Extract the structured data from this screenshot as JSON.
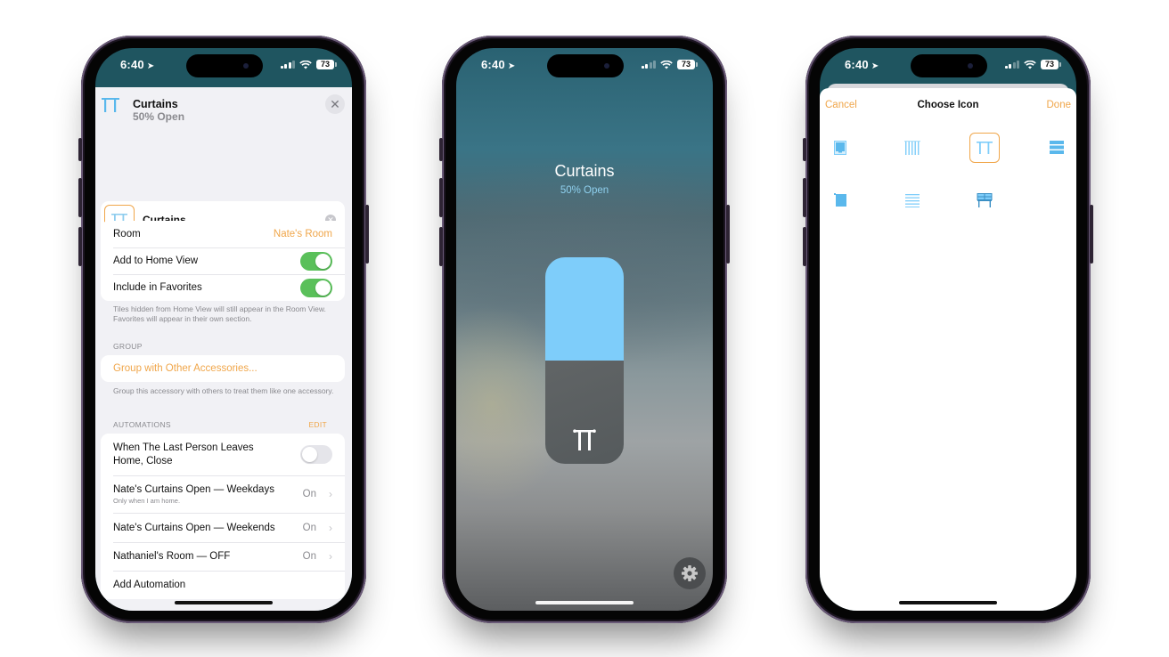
{
  "status_bar": {
    "time": "6:40",
    "battery": "73",
    "location_icon": "location-arrow-icon",
    "signal_icon": "cellular-signal-icon",
    "wifi_icon": "wifi-icon"
  },
  "colors": {
    "accent": "#f0a64a",
    "toggle_on": "#5ac05a",
    "slider_fill": "#7ecdfa",
    "sheet_bg": "#f1f1f5",
    "icon_blue": "#5ab8ec"
  },
  "settings_screen": {
    "header": {
      "icon": "curtains-icon",
      "title": "Curtains",
      "subtitle": "50% Open",
      "close_icon": "close-icon"
    },
    "name_field": {
      "icon": "curtains-icon",
      "value": "Curtains",
      "clear_icon": "clear-icon"
    },
    "general": {
      "rows": [
        {
          "label": "Room",
          "value": "Nate's Room"
        },
        {
          "label": "Add to Home View",
          "toggle": true
        },
        {
          "label": "Include in Favorites",
          "toggle": true
        }
      ],
      "footer": "Tiles hidden from Home View will still appear in the Room View. Favorites will appear in their own section."
    },
    "group": {
      "header": "GROUP",
      "action": "Group with Other Accessories...",
      "footer": "Group this accessory with others to treat them like one accessory."
    },
    "automations": {
      "header": "AUTOMATIONS",
      "edit_label": "EDIT",
      "items": [
        {
          "title": "When The Last Person Leaves Home, Close",
          "toggle": false
        },
        {
          "title": "Nate's Curtains Open — Weekdays",
          "subtitle": "Only when I am home.",
          "status": "On"
        },
        {
          "title": "Nate's Curtains Open — Weekends",
          "status": "On"
        },
        {
          "title": "Nathaniel's Room — OFF",
          "status": "On"
        }
      ],
      "add_label": "Add Automation"
    }
  },
  "control_screen": {
    "title": "Curtains",
    "subtitle": "50% Open",
    "slider": {
      "percent_open": 50,
      "icon": "curtains-icon"
    },
    "settings_icon": "gear-icon"
  },
  "choose_icon_screen": {
    "cancel_label": "Cancel",
    "title": "Choose Icon",
    "done_label": "Done",
    "icons": [
      {
        "name": "window-shade-icon",
        "selected": false
      },
      {
        "name": "vertical-blinds-icon",
        "selected": false
      },
      {
        "name": "curtains-icon",
        "selected": true
      },
      {
        "name": "horizontal-blinds-icon",
        "selected": false
      },
      {
        "name": "roller-shade-icon",
        "selected": false
      },
      {
        "name": "venetian-blinds-icon",
        "selected": false
      },
      {
        "name": "awning-icon",
        "selected": false
      }
    ]
  }
}
